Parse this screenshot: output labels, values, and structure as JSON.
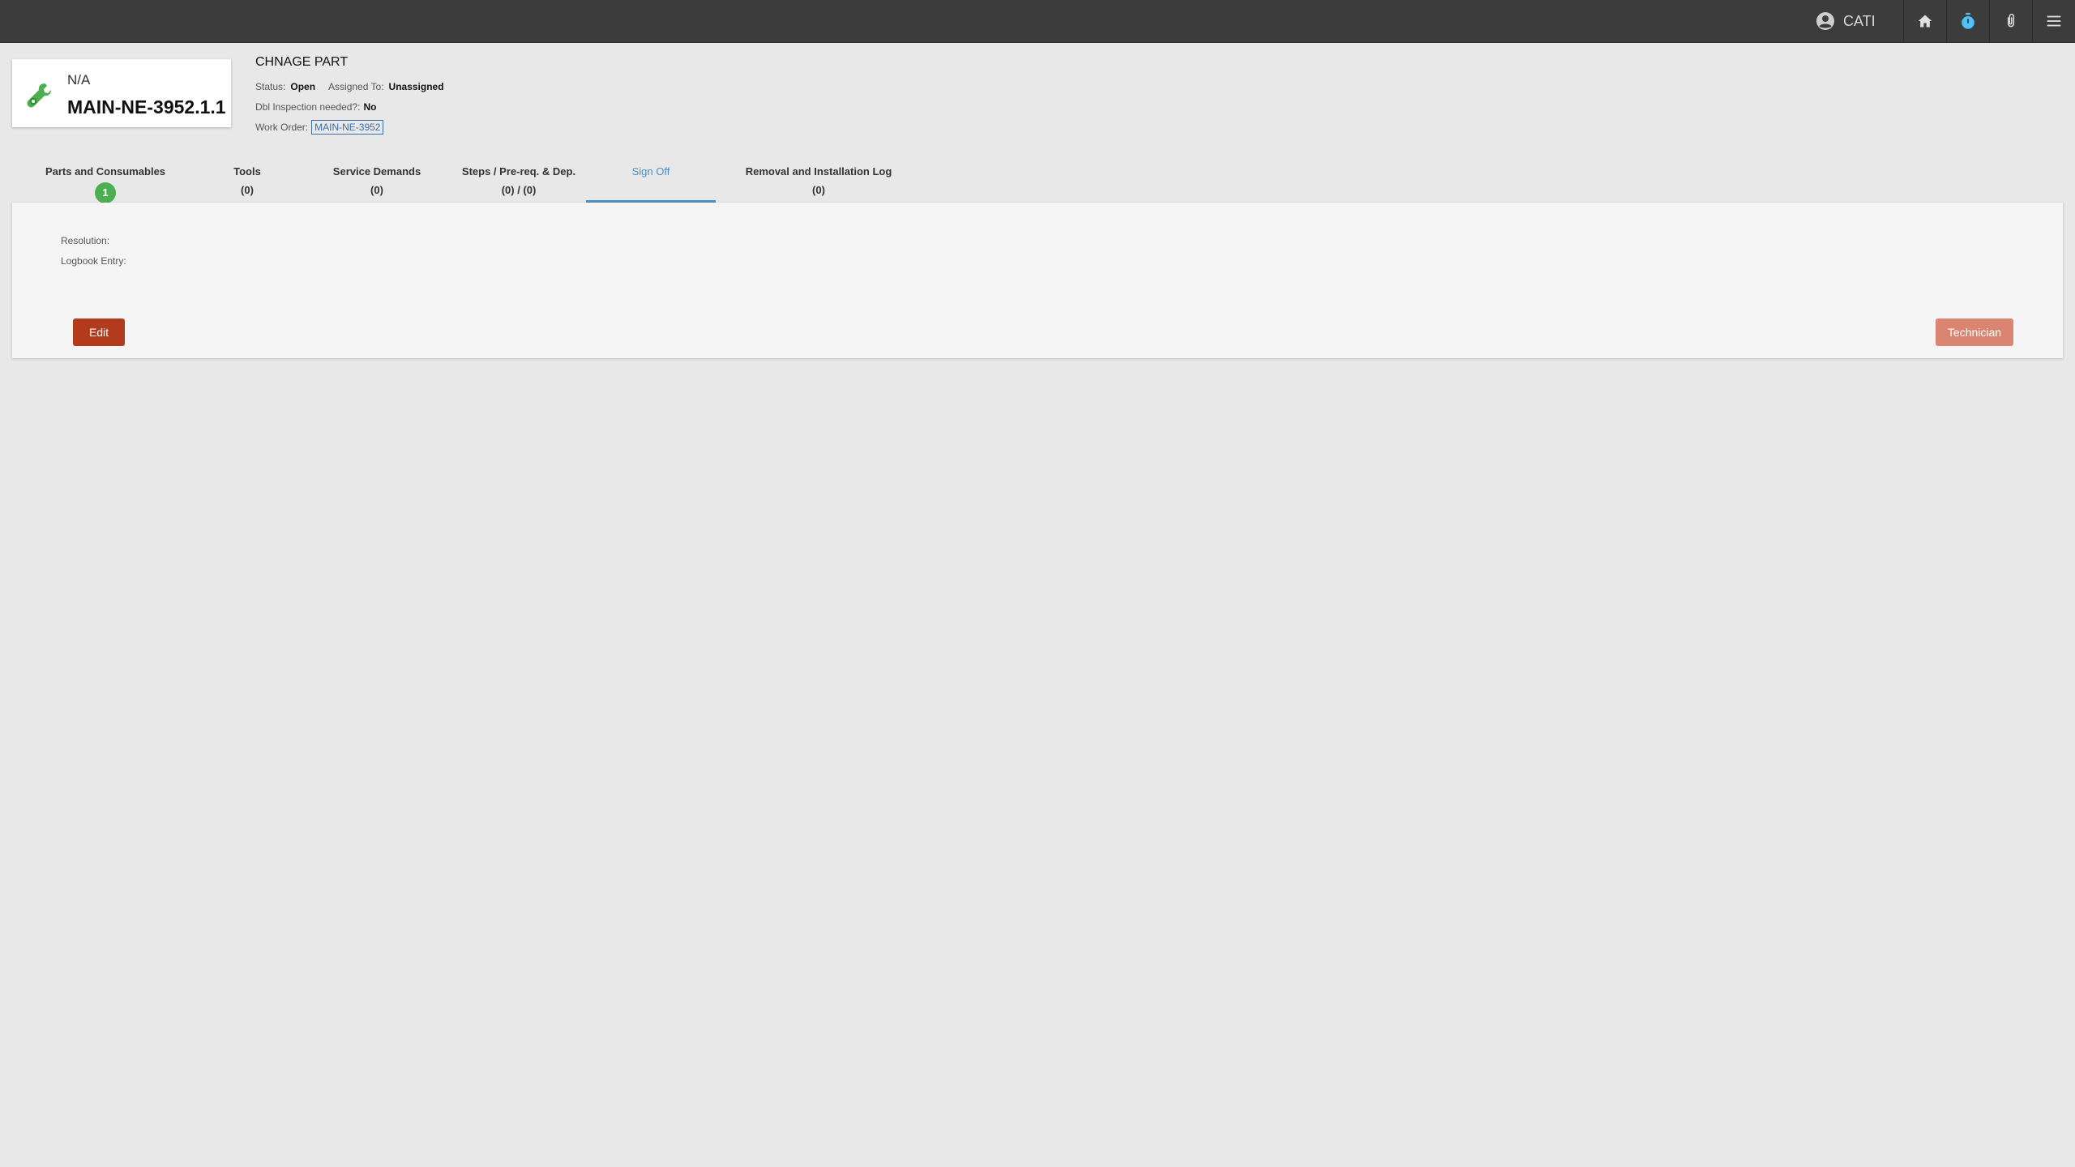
{
  "topbar": {
    "user_name": "CATI",
    "icons": [
      "account-circle-icon",
      "home-icon",
      "timer-icon",
      "paperclip-icon",
      "hamburger-menu-icon"
    ],
    "timer_color": "#4fc3f7"
  },
  "header": {
    "subtitle": "N/A",
    "code": "MAIN-NE-3952.1.1",
    "icon": "wrench-gear-icon"
  },
  "task": {
    "title": "CHNAGE PART",
    "status_label": "Status:",
    "status_value": "Open",
    "assigned_label": "Assigned To:",
    "assigned_value": "Unassigned",
    "dbl_label": "Dbl Inspection needed?:",
    "dbl_value": "No",
    "work_order_label": "Work Order:",
    "work_order_value": "MAIN-NE-3952"
  },
  "tabs": [
    {
      "label": "Parts and Consumables",
      "count": "1",
      "badge": true
    },
    {
      "label": "Tools",
      "count": "(0)"
    },
    {
      "label": "Service Demands",
      "count": "(0)"
    },
    {
      "label": "Steps / Pre-req. & Dep.",
      "count": "(0) / (0)"
    },
    {
      "label": "Sign Off",
      "count": "",
      "active": true
    },
    {
      "label": "Removal and Installation Log",
      "count": "(0)"
    }
  ],
  "signoff": {
    "resolution_label": "Resolution:",
    "logbook_label": "Logbook Entry:",
    "edit_label": "Edit",
    "technician_label": "Technician"
  },
  "colors": {
    "accent": "#4a90c8",
    "edit_button": "#b23b1e",
    "technician_button": "#d98572",
    "badge": "#4caf50"
  }
}
